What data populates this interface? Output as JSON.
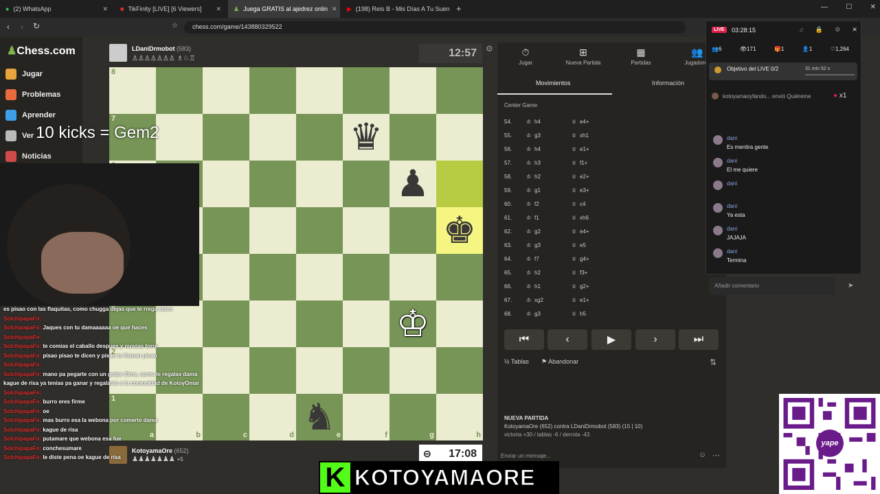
{
  "tabs": [
    {
      "label": "(2) WhatsApp"
    },
    {
      "label": "TikFinity [LIVE] [6 Viewers]"
    },
    {
      "label": "Juega GRATIS al ajedrez onlin"
    },
    {
      "label": "(198) Reis B - Mis Días A Tu Suen"
    }
  ],
  "url": "chess.com/game/143880329522",
  "nav": {
    "logo": "Chess.com",
    "items": [
      "Jugar",
      "Problemas",
      "Aprender",
      "Ver",
      "Noticias"
    ]
  },
  "overlay_kicks": "10 kicks = Gem2",
  "top_player": {
    "name": "LDaniDrmobot",
    "rating": "(583)",
    "clock": "12:57"
  },
  "bottom_player": {
    "name": "KotoyamaOre",
    "rating": "(652)",
    "captured": "+5",
    "clock": "17:08"
  },
  "files": [
    "a",
    "b",
    "c",
    "d",
    "e",
    "f",
    "g",
    "h"
  ],
  "ranks": [
    "8",
    "7",
    "6",
    "5",
    "4",
    "3",
    "2",
    "1"
  ],
  "board": [
    [
      "",
      "",
      "",
      "",
      "",
      "",
      "",
      ""
    ],
    [
      "",
      "",
      "",
      "",
      "",
      "♛",
      "",
      ""
    ],
    [
      "",
      "",
      "",
      "",
      "",
      "",
      "♟",
      ""
    ],
    [
      "",
      "",
      "",
      "",
      "",
      "",
      "",
      "♚"
    ],
    [
      "",
      "",
      "",
      "",
      "",
      "",
      "",
      ""
    ],
    [
      "",
      "",
      "",
      "",
      "",
      "",
      "♔",
      ""
    ],
    [
      "",
      "",
      "",
      "",
      "",
      "",
      "",
      ""
    ],
    [
      "",
      "",
      "",
      "",
      "♞",
      "",
      "",
      ""
    ]
  ],
  "panel_tabs": [
    "Jugar",
    "Nueva Partida",
    "Partidas",
    "Jugadores"
  ],
  "subtabs": [
    "Movimientos",
    "Información"
  ],
  "opening": "Center Game",
  "moves": [
    {
      "n": "54.",
      "w": "h4",
      "b": "e4+"
    },
    {
      "n": "55.",
      "w": "g3",
      "b": "xh1"
    },
    {
      "n": "56.",
      "w": "h4",
      "b": "e1+"
    },
    {
      "n": "57.",
      "w": "h3",
      "b": "f1+"
    },
    {
      "n": "58.",
      "w": "h2",
      "b": "e2+"
    },
    {
      "n": "59.",
      "w": "g1",
      "b": "e3+"
    },
    {
      "n": "60.",
      "w": "f2",
      "b": "c4"
    },
    {
      "n": "61.",
      "w": "f1",
      "b": "xh6"
    },
    {
      "n": "62.",
      "w": "g2",
      "b": "e4+"
    },
    {
      "n": "63.",
      "w": "g3",
      "b": "e5"
    },
    {
      "n": "64.",
      "w": "f7",
      "b": "g4+"
    },
    {
      "n": "65.",
      "w": "h2",
      "b": "f3+"
    },
    {
      "n": "66.",
      "w": "h1",
      "b": "g2+"
    },
    {
      "n": "67.",
      "w": "xg2",
      "b": "e1+"
    },
    {
      "n": "68.",
      "w": "g3",
      "b": "h5"
    }
  ],
  "controls": {
    "draw": "Tablas",
    "resign": "Abandonar"
  },
  "new_game": {
    "title": "NUEVA PARTIDA",
    "line": "KotoyamaOre (652) contra LDaniDrmobot (583) (15 | 10)",
    "stats": "victoria +30 / tablas -6 / derrota -43"
  },
  "message_placeholder": "Enviar un mensaje...",
  "live": {
    "badge": "LIVE",
    "time": "03:28:15",
    "stats": [
      "6",
      "171",
      "1",
      "1",
      "1,264"
    ],
    "goal": "Objetivo del LIVE 0/2",
    "goal_time": "31 min 52 s",
    "gift_line": "kotoyamaoyfando... envió Quiéreme",
    "gift_count": "x1",
    "chat": [
      {
        "user": "dani",
        "text": "Es mentira gente"
      },
      {
        "user": "dani",
        "text": "El me quiere"
      },
      {
        "user": "dani",
        "text": ""
      },
      {
        "user": "dani",
        "text": "Ya esta"
      },
      {
        "user": "dani",
        "text": "JAJAJA"
      },
      {
        "user": "dani",
        "text": "Termina"
      }
    ],
    "placeholder": "Añadir comentario"
  },
  "stream_chat": [
    {
      "user": "",
      "text": "es pisao con las flaquitas, como chugga dejas que te rrega wavo"
    },
    {
      "user": "SolchipapaFn:",
      "text": ""
    },
    {
      "user": "SolchipapaFn:",
      "text": "Jaques con tu damaaaaaa oe que haces"
    },
    {
      "user": "SolchipapaFn:",
      "text": ""
    },
    {
      "user": "SolchipapaFn:",
      "text": "te comias el caballo despues y movias torre"
    },
    {
      "user": "SolchipapaFn:",
      "text": "pisao pisao te dicen y pisao te llaman pisao"
    },
    {
      "user": "SolchipapaFn:",
      "text": ""
    },
    {
      "user": "SolchipapaFn:",
      "text": "mano pa pegarte con un golpe filme, como le regalas dama"
    },
    {
      "user": "",
      "text": "kague de risa ya tenias pa ganar y regalaste a la comunidad de KotoyOmar"
    },
    {
      "user": "SolchipapaFn:",
      "text": ""
    },
    {
      "user": "SolchipapaFn:",
      "text": "burro eres firme"
    },
    {
      "user": "SolchipapaFn:",
      "text": "oe"
    },
    {
      "user": "SolchipapaFn:",
      "text": "mas burro esa la webona por comerte dama"
    },
    {
      "user": "SolchipapaFn:",
      "text": "kague de risa"
    },
    {
      "user": "SolchipapaFn:",
      "text": "putamare que webona esa fue"
    },
    {
      "user": "SolchipapaFn:",
      "text": "conchesumare"
    },
    {
      "user": "SolchipapaFn:",
      "text": "le diste pena oe kague de risa"
    }
  ],
  "banner": "KOTOYAMAORE",
  "qr_label": "yape",
  "colors": {
    "light": "#ebecd0",
    "dark": "#779556",
    "accent": "#e03030"
  }
}
